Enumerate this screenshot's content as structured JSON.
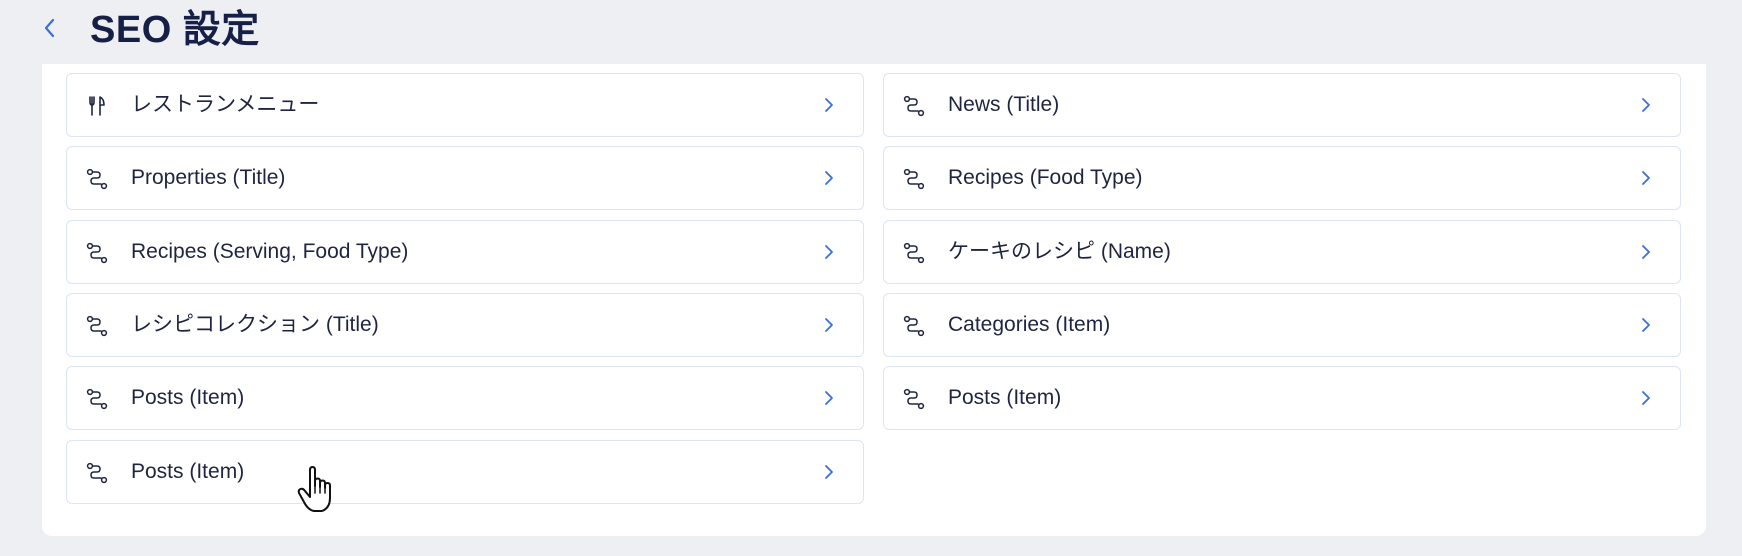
{
  "header": {
    "title": "SEO 設定",
    "back_icon": "chevron-left-icon"
  },
  "colors": {
    "accent": "#3B6FD8",
    "background": "#EEEFF3",
    "card_border": "#DCE5F3",
    "text": "#1F2540",
    "title": "#162046"
  },
  "items": {
    "left": [
      {
        "label": "レストランメニュー",
        "icon": "fork-knife-icon"
      },
      {
        "label": "Properties (Title)",
        "icon": "route-icon"
      },
      {
        "label": "Recipes (Serving, Food Type)",
        "icon": "route-icon"
      },
      {
        "label": "レシピコレクション (Title)",
        "icon": "route-icon"
      },
      {
        "label": "Posts (Item)",
        "icon": "route-icon"
      },
      {
        "label": "Posts (Item)",
        "icon": "route-icon"
      }
    ],
    "right": [
      {
        "label": "News (Title)",
        "icon": "route-icon"
      },
      {
        "label": "Recipes (Food Type)",
        "icon": "route-icon"
      },
      {
        "label": "ケーキのレシピ (Name)",
        "icon": "route-icon"
      },
      {
        "label": "Categories (Item)",
        "icon": "route-icon"
      },
      {
        "label": "Posts (Item)",
        "icon": "route-icon"
      }
    ]
  }
}
